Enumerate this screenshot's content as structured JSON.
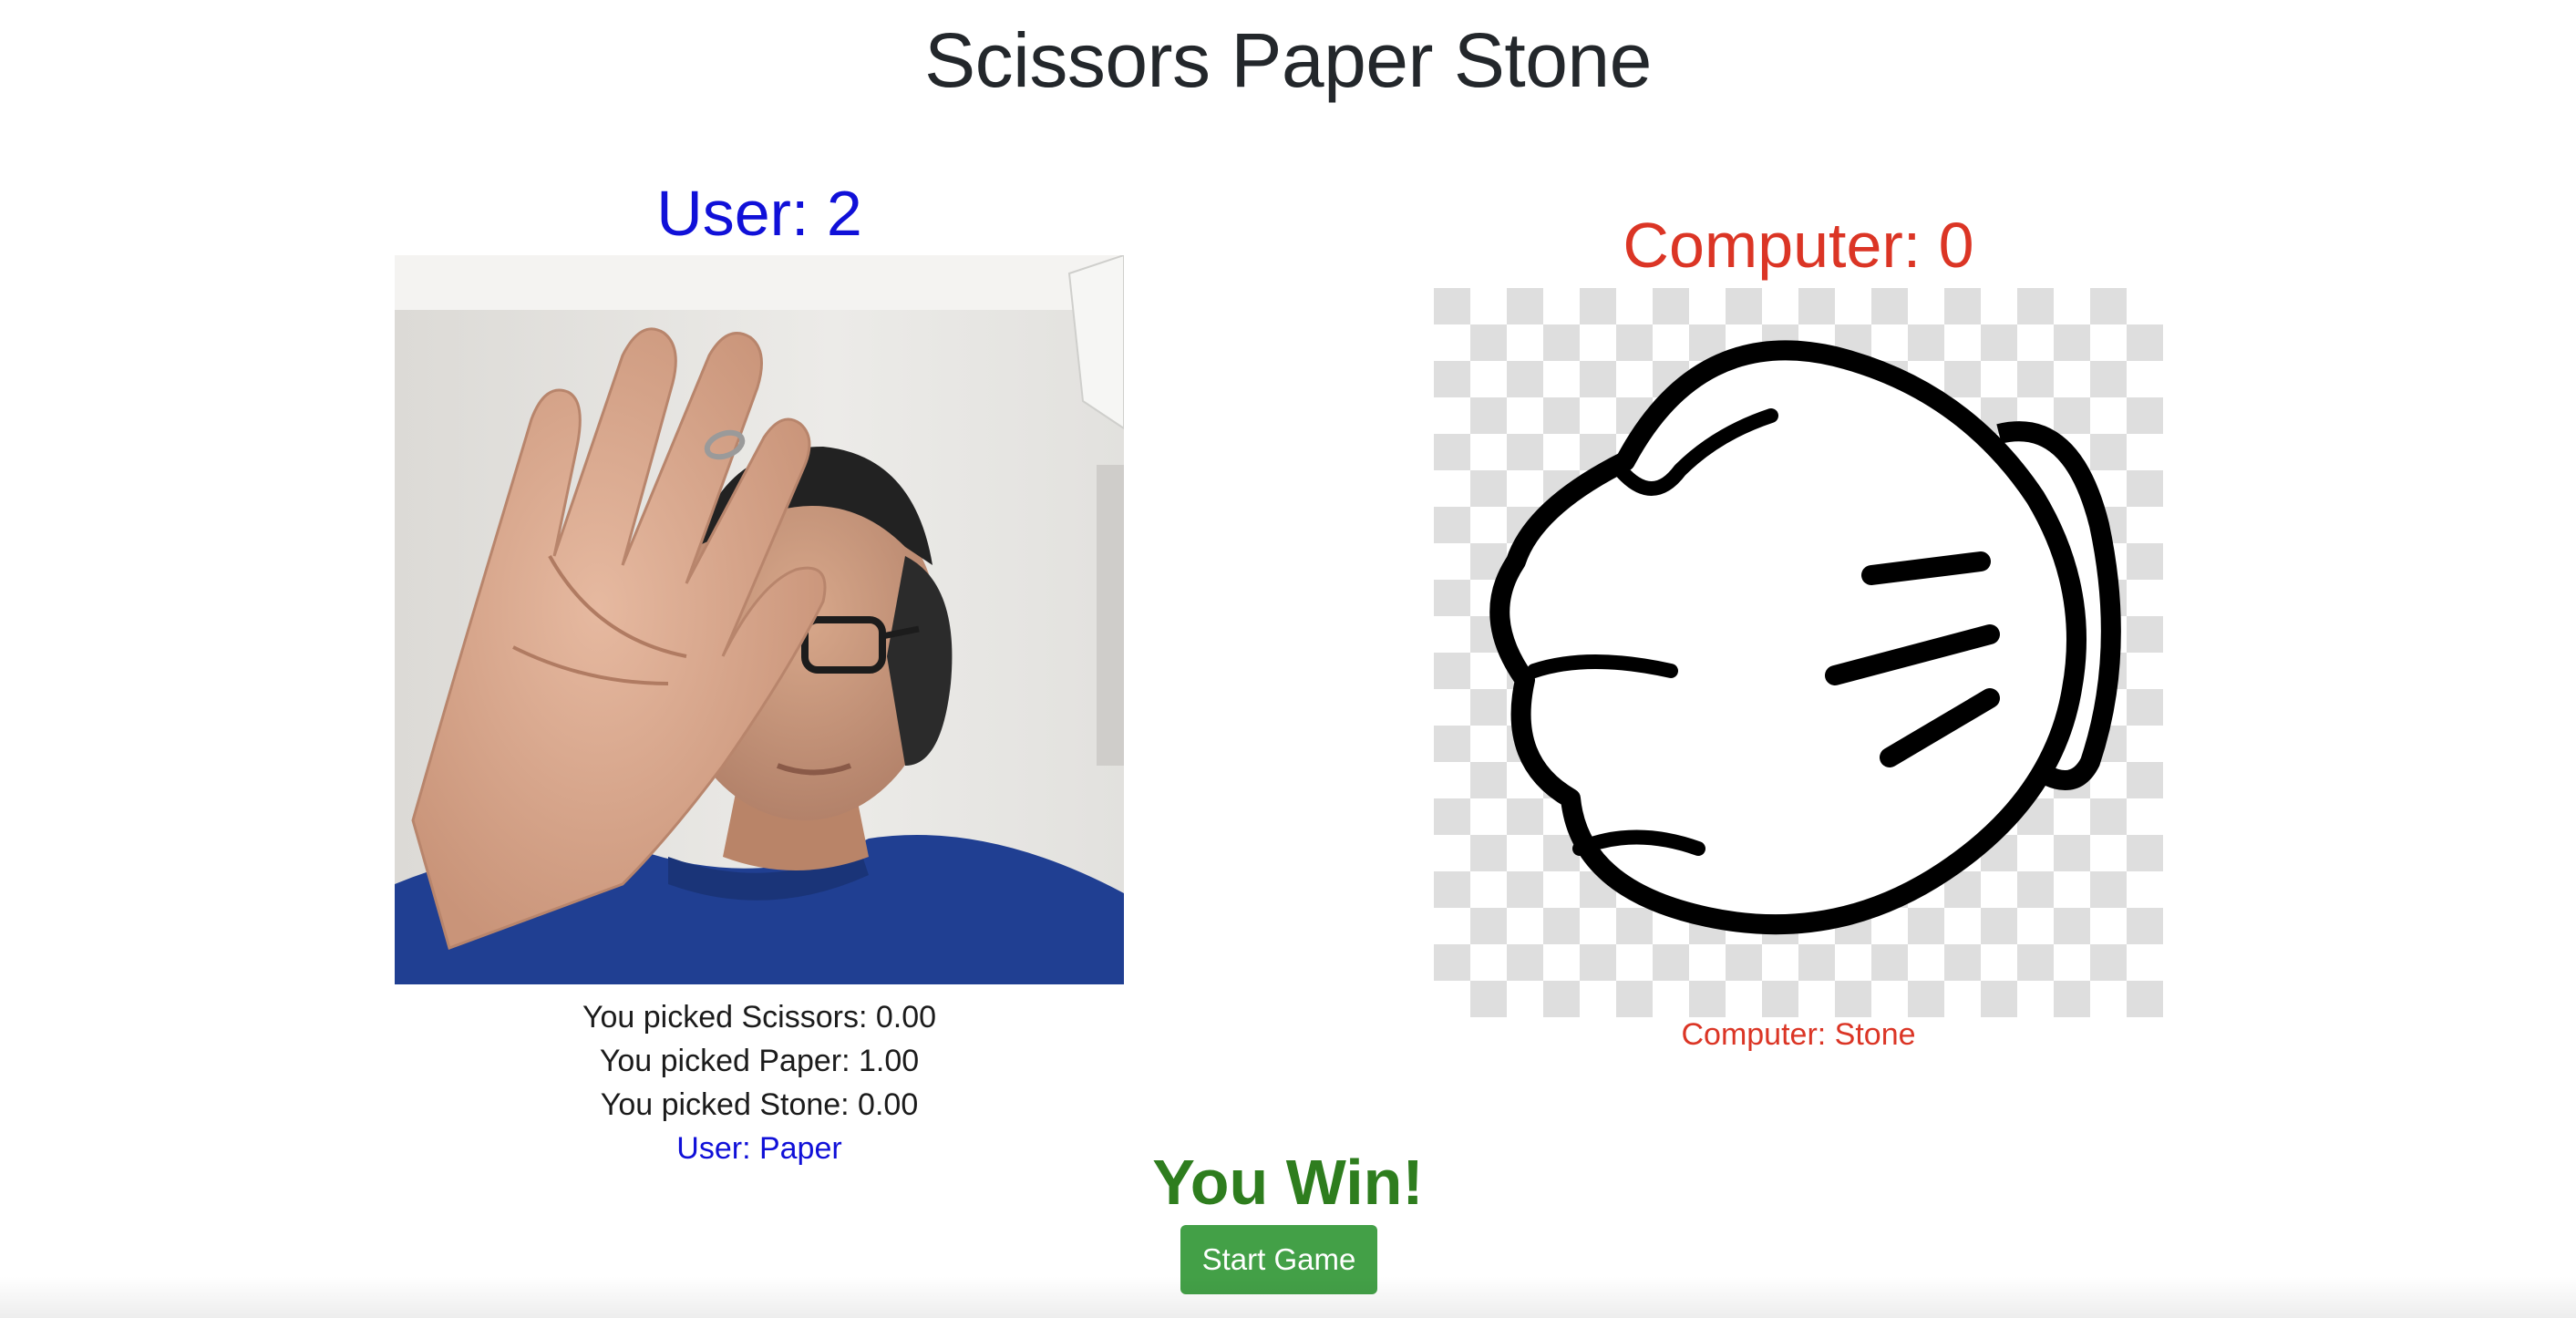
{
  "page": {
    "title": "Scissors Paper Stone"
  },
  "user": {
    "score_label": "User: 2",
    "probabilities": [
      "You picked Scissors: 0.00",
      "You picked Paper: 1.00",
      "You picked Stone: 0.00"
    ],
    "pick_label": "User: Paper",
    "camera_icon": "webcam-hand-paper"
  },
  "computer": {
    "score_label": "Computer: 0",
    "pick_label": "Computer: Stone",
    "hand_icon": "cartoon-fist-icon"
  },
  "result": {
    "text": "You Win!"
  },
  "controls": {
    "start_label": "Start Game"
  },
  "colors": {
    "user": "#1010d8",
    "computer": "#db3525",
    "win": "#2e7d1e",
    "button": "#43a047"
  }
}
